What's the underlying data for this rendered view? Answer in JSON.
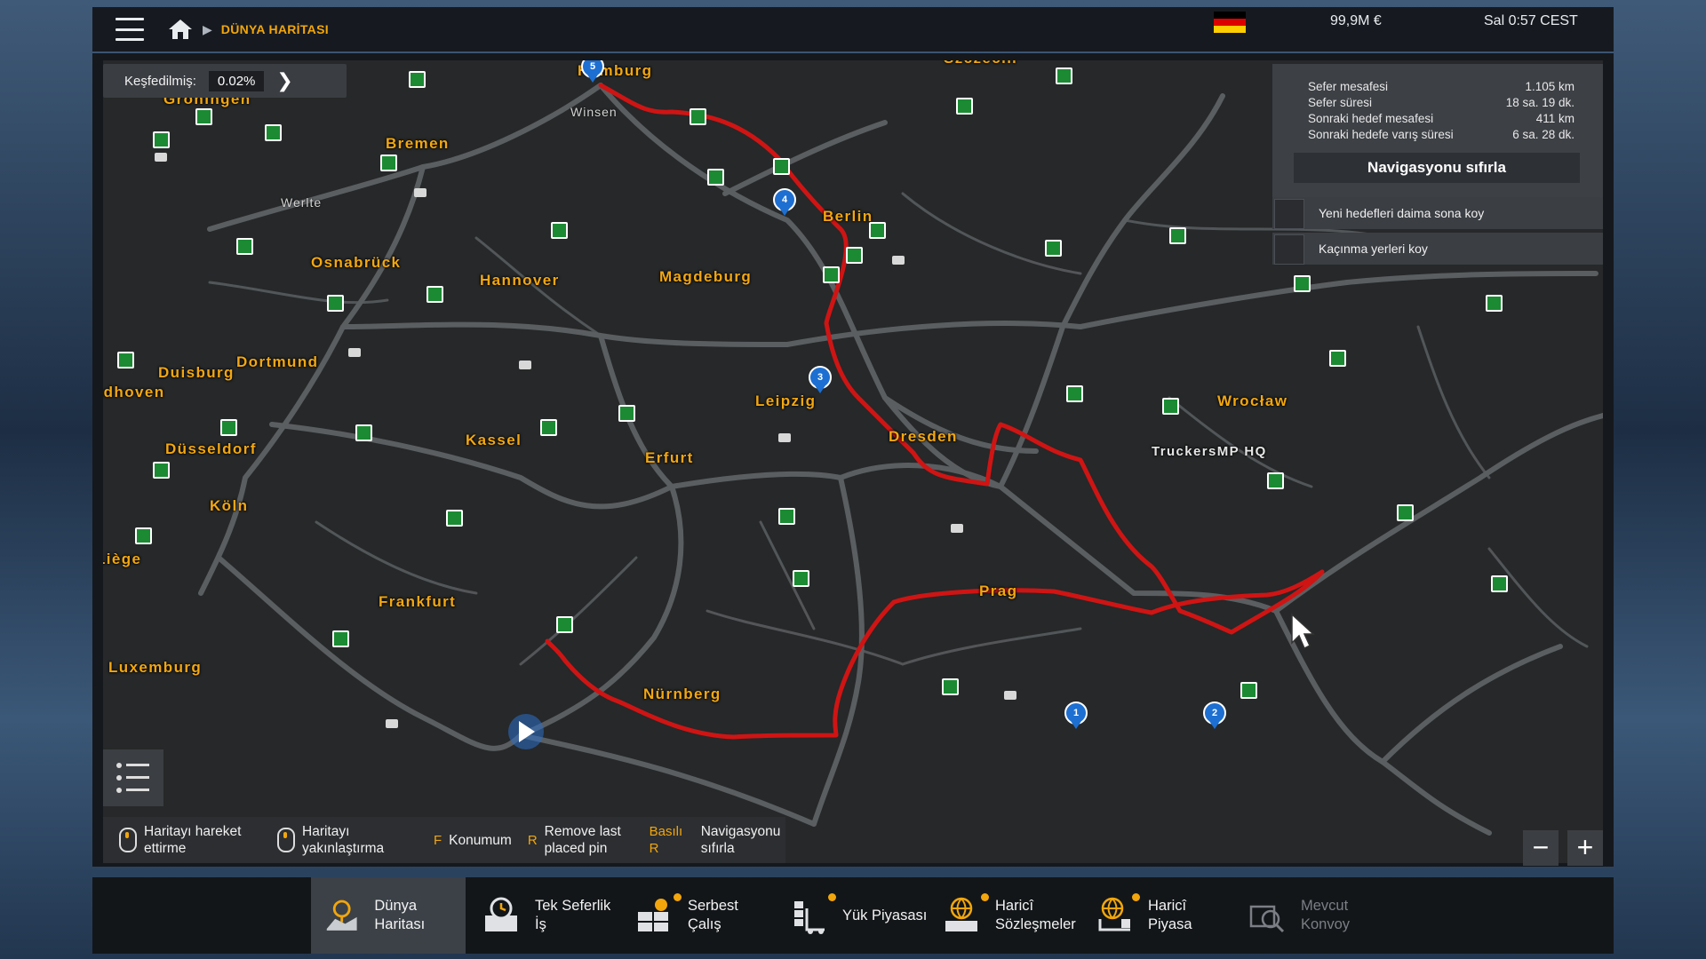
{
  "topbar": {
    "breadcrumb": "DÜNYA HARİTASI",
    "money": "99,9M  €",
    "clock": "Sal 0:57 CEST",
    "flag_colors": [
      "#000000",
      "#dd0000",
      "#ffce00"
    ]
  },
  "explored": {
    "label": "Keşfedilmiş:",
    "value": "0.02%"
  },
  "route_info": {
    "rows": [
      {
        "label": "Sefer mesafesi",
        "value": "1.105 km"
      },
      {
        "label": "Sefer süresi",
        "value": "18 sa. 19 dk."
      },
      {
        "label": "Sonraki hedef mesafesi",
        "value": "411 km"
      },
      {
        "label": "Sonraki hedefe varış süresi",
        "value": "6 sa. 28 dk."
      }
    ],
    "reset_button": "Navigasyonu sıfırla",
    "options": [
      "Yeni hedefleri daima sona koy",
      "Kaçınma yerleri koy"
    ]
  },
  "map": {
    "cities": [
      "Hamburg",
      "Groningen",
      "Bremen",
      "Osnabrück",
      "Hannover",
      "Magdeburg",
      "Berlin",
      "Szczecin",
      "Duisburg",
      "Dortmund",
      "Düsseldorf",
      "Köln",
      "Liège",
      "Kassel",
      "Erfurt",
      "Leipzig",
      "Dresden",
      "Wrocław",
      "Frankfurt",
      "Nürnberg",
      "Prag",
      "TruckersMP HQ",
      "Luxemburg",
      "Eindhoven"
    ],
    "towns": [
      "Winsen",
      "Werlte"
    ],
    "pins": [
      "5",
      "4",
      "3",
      "2",
      "1"
    ],
    "route_color": "#cf1414"
  },
  "hints": [
    {
      "key": "",
      "text": "Haritayı hareket ettirme",
      "icon": "mouse-drag-icon"
    },
    {
      "key": "",
      "text": "Haritayı yakınlaştırma",
      "icon": "mouse-wheel-icon"
    },
    {
      "key": "F",
      "text": "Konumum"
    },
    {
      "key": "R",
      "text": "Remove last placed pin"
    },
    {
      "key": "Basılı R",
      "text": "Navigasyonu sıfırla"
    }
  ],
  "zoom": {
    "out": "−",
    "in": "+"
  },
  "bottom_nav": [
    {
      "label": "Dünya Haritası",
      "active": true,
      "dot": false,
      "icon": "world-map-icon"
    },
    {
      "label": "Tek Seferlik İş",
      "active": false,
      "dot": false,
      "icon": "clock-job-icon"
    },
    {
      "label": "Serbest Çalış",
      "active": false,
      "dot": true,
      "icon": "freight-market-icon"
    },
    {
      "label": "Yük Piyasası",
      "active": false,
      "dot": true,
      "icon": "cargo-market-icon"
    },
    {
      "label": "Haricî Sözleşmeler",
      "active": false,
      "dot": true,
      "icon": "external-contracts-icon"
    },
    {
      "label": "Haricî Piyasa",
      "active": false,
      "dot": true,
      "icon": "external-market-icon"
    },
    {
      "label": "Mevcut Konvoy",
      "active": false,
      "dot": false,
      "disabled": true,
      "icon": "convoy-icon"
    }
  ]
}
